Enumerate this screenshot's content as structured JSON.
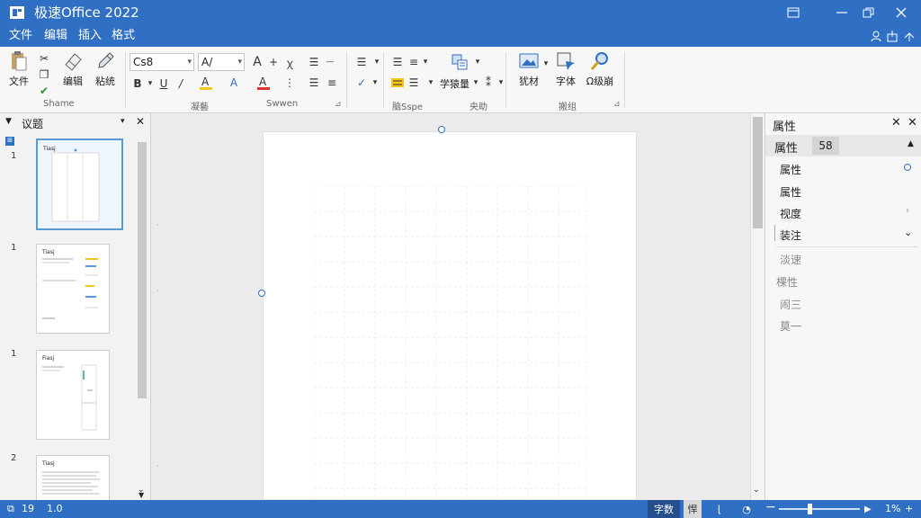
{
  "title_bar": {
    "title": "极速Office 2022"
  },
  "menu": {
    "items": [
      "文件",
      "编辑",
      "插入",
      "格式"
    ]
  },
  "ribbon": {
    "buttons": {
      "file": "文件",
      "edit": "编辑",
      "paste": "粘统"
    },
    "font": {
      "name": "Cs8",
      "size": "A/"
    },
    "group_labels": {
      "g1": "Shame",
      "g2": "凝藝",
      "g3": "Swwen",
      "g4": "脑Sspe",
      "g5": "央助",
      "g6": "搬组"
    },
    "arrange_label": "学猿量",
    "right_buttons": {
      "material": "犹材",
      "font": "字体",
      "find": "Ω级崩"
    }
  },
  "left_panel": {
    "title": "议题",
    "thumbs": [
      {
        "num": "1",
        "label": "Tiasj"
      },
      {
        "num": "1",
        "label": "Tiasj"
      },
      {
        "num": "1",
        "label": "Fiasj"
      },
      {
        "num": "2",
        "label": "Tiasj"
      }
    ]
  },
  "right_panel": {
    "title": "属性",
    "sub_title": "属性",
    "size_box": "58",
    "rows": [
      "属性",
      "属性",
      "视度",
      "装注"
    ],
    "dim_rows": [
      "淡速",
      "棵性",
      "闹三",
      "莫一"
    ]
  },
  "status": {
    "left1": "19",
    "left2": "1.0",
    "mode": "字数",
    "mode2": "悍",
    "zoom": "1%"
  },
  "colors": {
    "accent": "#2f6fc4",
    "highlight": "#f5c518",
    "font_color": "#e03030"
  }
}
